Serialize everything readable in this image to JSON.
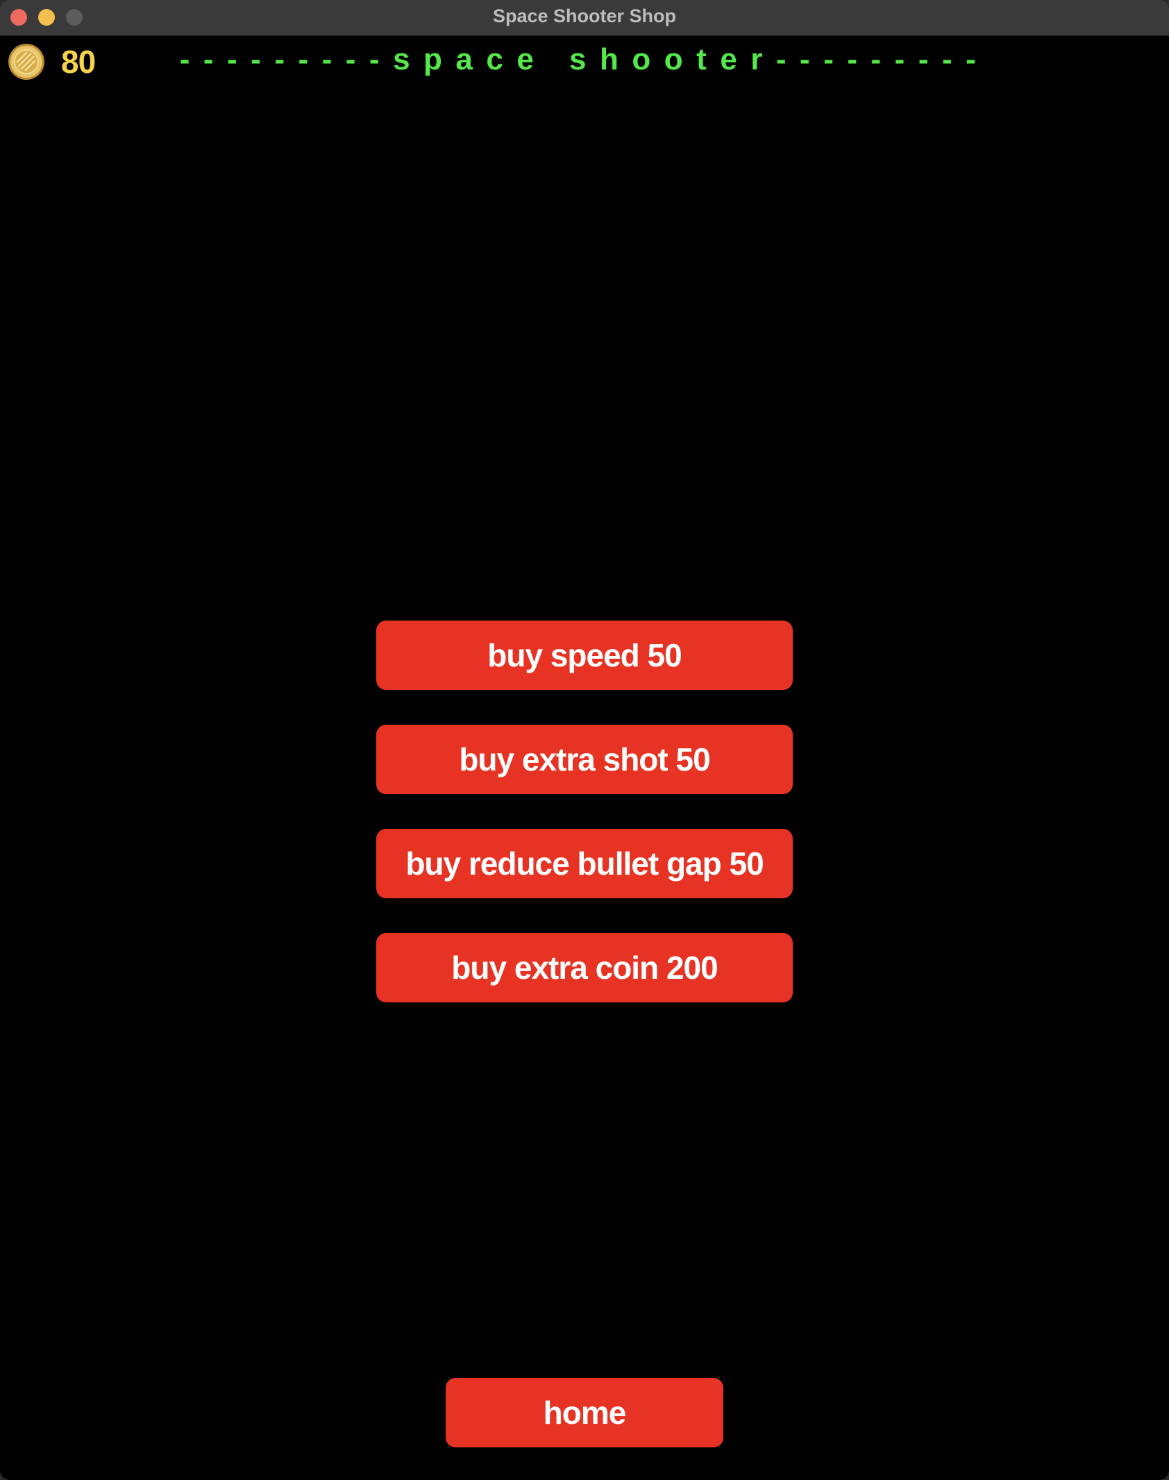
{
  "window": {
    "title": "Space Shooter Shop"
  },
  "hud": {
    "coin_icon": "coin-icon",
    "coins": "80"
  },
  "banner": {
    "text": "---------space shooter---------"
  },
  "shop": {
    "items": [
      {
        "label": "buy speed 50"
      },
      {
        "label": "buy extra shot 50"
      },
      {
        "label": "buy reduce bullet gap 50"
      },
      {
        "label": "buy extra coin 200"
      }
    ]
  },
  "nav": {
    "home_label": "home"
  },
  "colors": {
    "background": "#000000",
    "button": "#e63323",
    "button_text": "#ffffff",
    "coin_text": "#f7d24a",
    "banner_text": "#55e84a"
  }
}
